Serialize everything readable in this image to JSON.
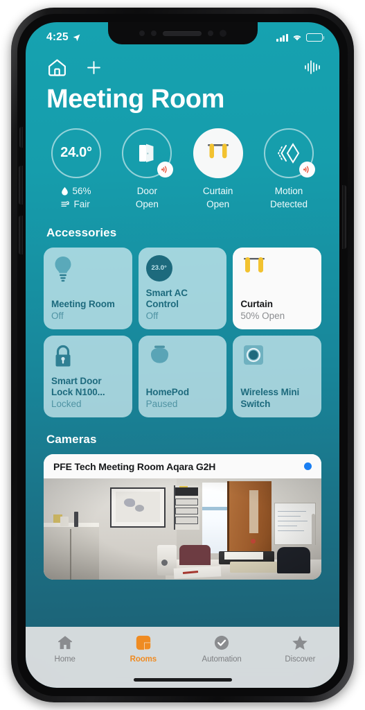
{
  "status_bar": {
    "time": "4:25",
    "location_icon": "location-arrow-icon",
    "cellular_icon": "cellular-bars-icon",
    "wifi_icon": "wifi-icon",
    "battery_icon": "battery-icon"
  },
  "nav": {
    "home_icon": "home-outline-icon",
    "add_icon": "plus-icon",
    "voice_icon": "voice-waveform-icon"
  },
  "header": {
    "title": "Meeting Room"
  },
  "status_circles": [
    {
      "type": "climate",
      "temperature": "24.0°",
      "humidity": "56%",
      "air_quality": "Fair",
      "humidity_icon": "water-drop-icon",
      "air_icon": "air-quality-icon",
      "highlighted": false,
      "alert": false
    },
    {
      "type": "door",
      "label_line1": "Door",
      "label_line2": "Open",
      "icon": "door-open-icon",
      "highlighted": false,
      "alert": true,
      "alert_icon": "signal-alert-icon"
    },
    {
      "type": "curtain",
      "label_line1": "Curtain",
      "label_line2": "Open",
      "icon": "curtain-icon",
      "highlighted": true,
      "alert": false
    },
    {
      "type": "motion",
      "label_line1": "Motion",
      "label_line2": "Detected",
      "icon": "motion-sensor-icon",
      "highlighted": false,
      "alert": true,
      "alert_icon": "signal-alert-icon"
    }
  ],
  "accessories_section": {
    "title": "Accessories",
    "items": [
      {
        "name": "Meeting Room",
        "state": "Off",
        "icon": "lightbulb-icon",
        "active": false
      },
      {
        "name": "Smart AC Control",
        "state": "Off",
        "icon": "ac-thermostat-icon",
        "badge": "23.0°",
        "active": false
      },
      {
        "name": "Curtain",
        "state": "50% Open",
        "icon": "curtain-icon",
        "active": true
      },
      {
        "name": "Smart Door Lock N100...",
        "state": "Locked",
        "icon": "padlock-icon",
        "active": false
      },
      {
        "name": "HomePod",
        "state": "Paused",
        "icon": "homepod-icon",
        "active": false
      },
      {
        "name": "Wireless Mini Switch",
        "state": "",
        "icon": "mini-switch-icon",
        "active": false
      }
    ]
  },
  "cameras_section": {
    "title": "Cameras",
    "camera": {
      "name": "PFE Tech Meeting Room Aqara G2H",
      "status_dot_color": "#1a7ef2",
      "feed_description": "Office room live view"
    }
  },
  "tab_bar": {
    "tabs": [
      {
        "label": "Home",
        "icon": "home-filled-icon",
        "active": false
      },
      {
        "label": "Rooms",
        "icon": "rooms-icon",
        "active": true
      },
      {
        "label": "Automation",
        "icon": "clock-check-icon",
        "active": false
      },
      {
        "label": "Discover",
        "icon": "star-icon",
        "active": false
      }
    ],
    "active_color": "#ef8b22",
    "inactive_color": "#7d7f82"
  },
  "theme": {
    "bg_top": "#16a2b0",
    "bg_bottom": "#1d5e72",
    "card_bg": "#d3ecf1",
    "card_text": "#1d6a7d",
    "accent_yellow": "#f2c230",
    "alert_red": "#e8523a"
  }
}
